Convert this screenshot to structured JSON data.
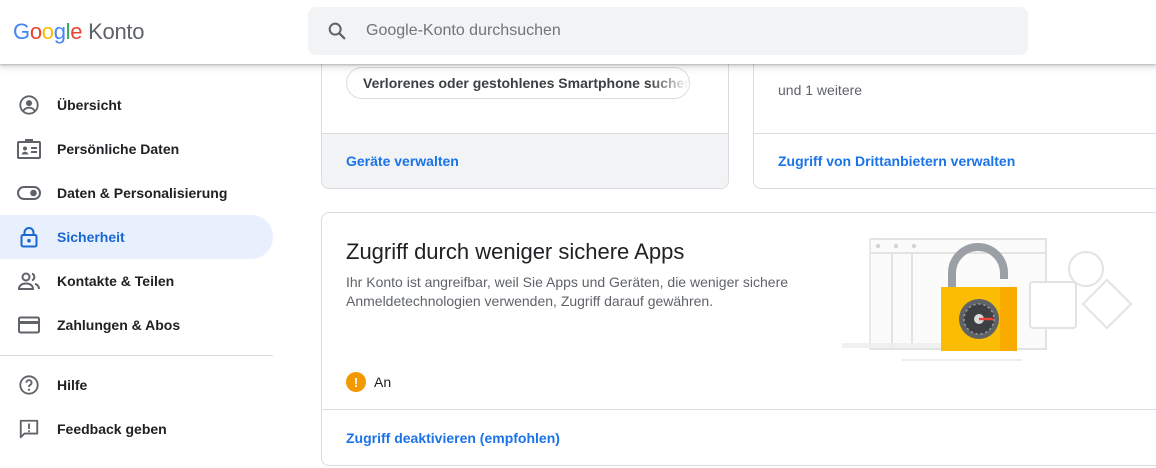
{
  "header": {
    "logo_letters": [
      "G",
      "o",
      "o",
      "g",
      "l",
      "e"
    ],
    "product_name": "Konto",
    "search": {
      "placeholder": "Google-Konto durchsuchen",
      "value": ""
    }
  },
  "sidebar": {
    "items": [
      {
        "label": "Übersicht",
        "icon": "account-circle-icon",
        "active": false
      },
      {
        "label": "Persönliche Daten",
        "icon": "id-card-icon",
        "active": false
      },
      {
        "label": "Daten & Personalisierung",
        "icon": "toggle-icon",
        "active": false
      },
      {
        "label": "Sicherheit",
        "icon": "lock-icon",
        "active": true
      },
      {
        "label": "Kontakte & Teilen",
        "icon": "people-icon",
        "active": false
      },
      {
        "label": "Zahlungen & Abos",
        "icon": "credit-card-icon",
        "active": false
      },
      {
        "label": "Hilfe",
        "icon": "help-icon",
        "active": false
      },
      {
        "label": "Feedback geben",
        "icon": "feedback-icon",
        "active": false
      }
    ]
  },
  "devices_card": {
    "chip_label": "Verlorenes oder gestohlenes Smartphone suchen",
    "link": "Geräte verwalten"
  },
  "third_party_card": {
    "more_text": "und 1 weitere",
    "link": "Zugriff von Drittanbietern verwalten"
  },
  "less_secure_card": {
    "title": "Zugriff durch weniger sichere Apps",
    "description": "Ihr Konto ist angreifbar, weil Sie Apps und Geräten, die weniger sichere Anmeldetechnologien verwenden, Zugriff darauf gewähren.",
    "status_icon": "!",
    "status_text": "An",
    "link": "Zugriff deaktivieren (empfohlen)"
  },
  "colors": {
    "accent": "#1a73e8",
    "active_bg": "#e8f0fe",
    "warning": "#f29900",
    "lock_yellow": "#fbbc04"
  }
}
